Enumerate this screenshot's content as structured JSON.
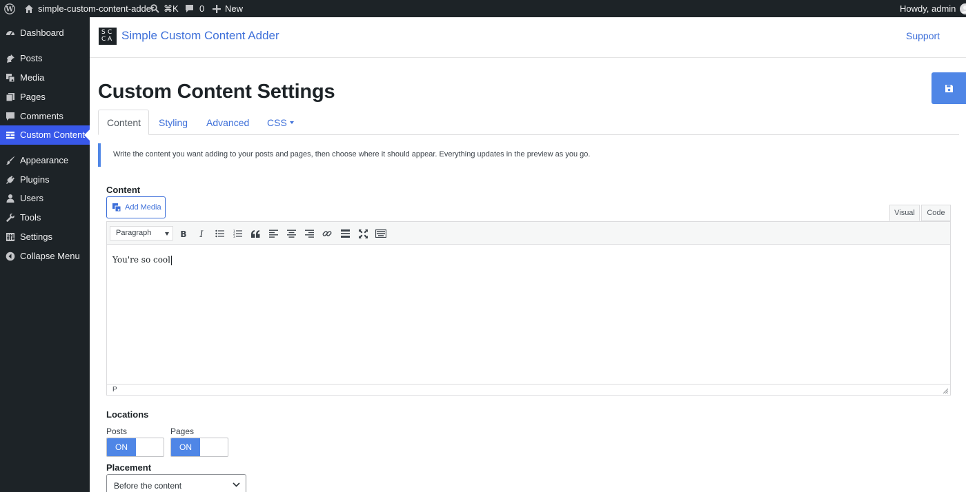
{
  "admin_bar": {
    "site_name": "simple-custom-content-adder",
    "shortcut": "⌘K",
    "comments_count": "0",
    "new_label": "New",
    "greeting": "Howdy, admin"
  },
  "sidebar": {
    "items": [
      {
        "label": "Dashboard",
        "icon": "dashboard-icon"
      },
      {
        "label": "Posts",
        "icon": "pin-icon"
      },
      {
        "label": "Media",
        "icon": "media-icon"
      },
      {
        "label": "Pages",
        "icon": "pages-icon"
      },
      {
        "label": "Comments",
        "icon": "comment-icon"
      },
      {
        "label": "Custom Content",
        "icon": "list-icon",
        "current": true
      },
      {
        "label": "Appearance",
        "icon": "brush-icon"
      },
      {
        "label": "Plugins",
        "icon": "plug-icon"
      },
      {
        "label": "Users",
        "icon": "user-icon"
      },
      {
        "label": "Tools",
        "icon": "wrench-icon"
      },
      {
        "label": "Settings",
        "icon": "settings-icon"
      },
      {
        "label": "Collapse Menu",
        "icon": "collapse-icon"
      }
    ]
  },
  "plugin_header": {
    "logo_text": "SCCA",
    "title": "Simple Custom Content Adder",
    "support": "Support"
  },
  "page": {
    "title": "Custom Content Settings",
    "tabs": [
      {
        "label": "Content",
        "active": true
      },
      {
        "label": "Styling"
      },
      {
        "label": "Advanced"
      },
      {
        "label": "CSS",
        "dropdown": true
      }
    ],
    "notice": "Write the content you want adding to your posts and pages, then choose where it should appear. Everything updates in the preview as you go."
  },
  "content_field": {
    "label": "Content",
    "add_media": "Add Media",
    "modes": [
      "Visual",
      "Code"
    ],
    "format": "Paragraph",
    "text": "You're so cool",
    "path": "P"
  },
  "locations": {
    "label": "Locations",
    "posts_label": "Posts",
    "pages_label": "Pages",
    "posts_state": "ON",
    "pages_state": "ON"
  },
  "placement": {
    "label": "Placement",
    "value": "Before the content"
  },
  "colors": {
    "accent": "#3d6fd9",
    "admin_dark": "#1d2327",
    "current_menu": "#3858e9",
    "toggle_on": "#4f86e6"
  }
}
